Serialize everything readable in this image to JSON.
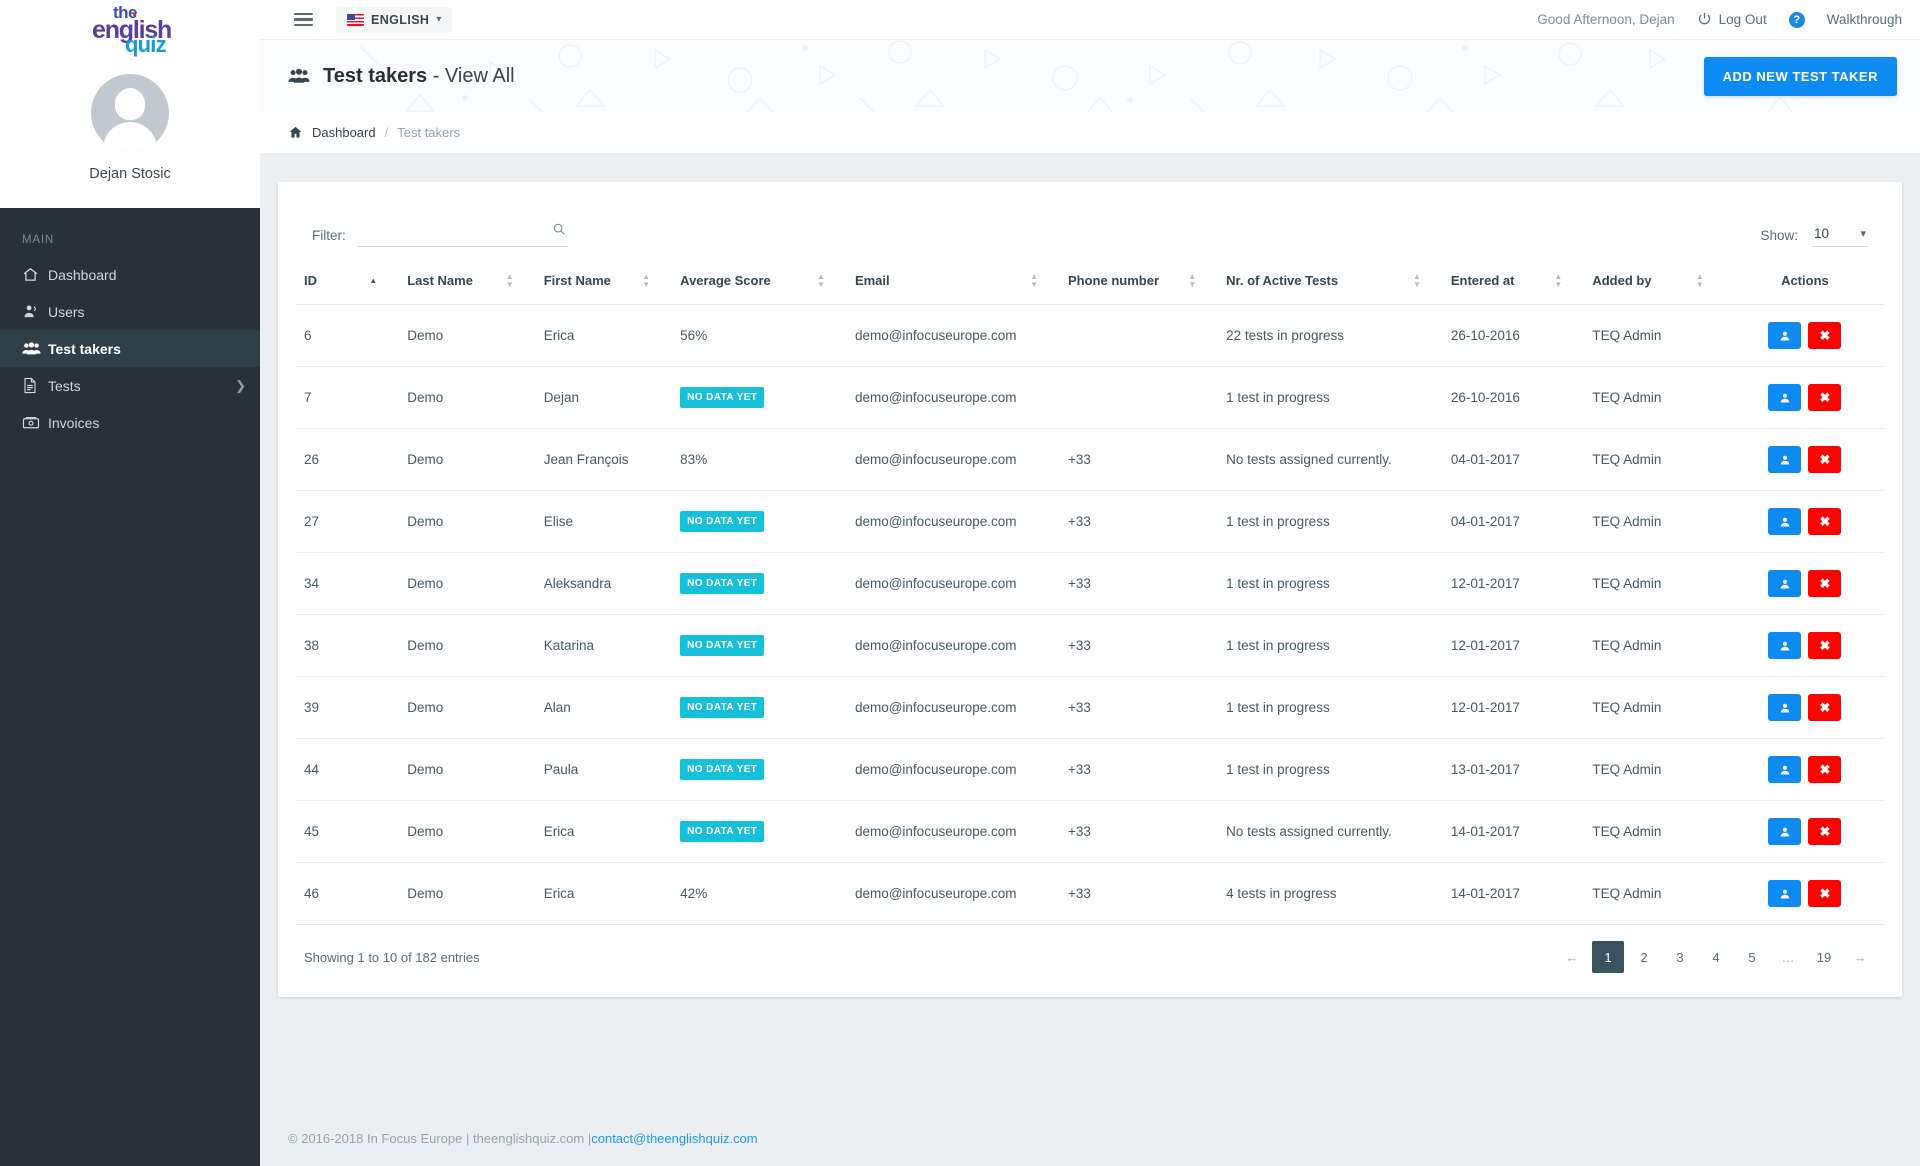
{
  "sidebar": {
    "logo": {
      "line1": "the",
      "line2": "english",
      "line3": "quiz"
    },
    "profile_name": "Dejan Stosic",
    "section_label": "MAIN",
    "items": [
      {
        "label": "Dashboard",
        "icon": "home-icon"
      },
      {
        "label": "Users",
        "icon": "user-icon"
      },
      {
        "label": "Test takers",
        "icon": "users-group-icon"
      },
      {
        "label": "Tests",
        "icon": "document-icon"
      },
      {
        "label": "Invoices",
        "icon": "money-icon"
      }
    ]
  },
  "topbar": {
    "language": "ENGLISH",
    "greeting": "Good Afternoon, Dejan",
    "logout": "Log Out",
    "help": "?",
    "walkthrough": "Walkthrough"
  },
  "pagehead": {
    "title": "Test takers",
    "subtitle": "- View All",
    "add_button": "ADD NEW TEST TAKER"
  },
  "breadcrumb": {
    "home": "home-icon",
    "parent": "Dashboard",
    "sep": "/",
    "current": "Test takers"
  },
  "toolbar": {
    "filter_label": "Filter:",
    "filter_value": "",
    "filter_placeholder": "",
    "show_label": "Show:",
    "show_value": "10"
  },
  "table": {
    "columns": [
      {
        "label": "ID",
        "sort": "asc"
      },
      {
        "label": "Last Name",
        "sort": "none"
      },
      {
        "label": "First Name",
        "sort": "none"
      },
      {
        "label": "Average Score",
        "sort": "none"
      },
      {
        "label": "Email",
        "sort": "none"
      },
      {
        "label": "Phone number",
        "sort": "none"
      },
      {
        "label": "Nr. of Active Tests",
        "sort": "none"
      },
      {
        "label": "Entered at",
        "sort": "none"
      },
      {
        "label": "Added by",
        "sort": "none"
      },
      {
        "label": "Actions",
        "sort": ""
      }
    ],
    "rows": [
      {
        "id": "6",
        "last": "Demo",
        "first": "Erica",
        "score": "56%",
        "badge": false,
        "email": "demo@infocuseurope.com",
        "phone": "",
        "tests": "22 tests in progress",
        "entered": "26-10-2016",
        "added": "TEQ Admin"
      },
      {
        "id": "7",
        "last": "Demo",
        "first": "Dejan",
        "score": "NO DATA YET",
        "badge": true,
        "email": "demo@infocuseurope.com",
        "phone": "",
        "tests": "1 test in progress",
        "entered": "26-10-2016",
        "added": "TEQ Admin"
      },
      {
        "id": "26",
        "last": "Demo",
        "first": "Jean François",
        "score": "83%",
        "badge": false,
        "email": "demo@infocuseurope.com",
        "phone": "+33",
        "tests": "No tests assigned currently.",
        "entered": "04-01-2017",
        "added": "TEQ Admin"
      },
      {
        "id": "27",
        "last": "Demo",
        "first": "Elise",
        "score": "NO DATA YET",
        "badge": true,
        "email": "demo@infocuseurope.com",
        "phone": "+33",
        "tests": "1 test in progress",
        "entered": "04-01-2017",
        "added": "TEQ Admin"
      },
      {
        "id": "34",
        "last": "Demo",
        "first": "Aleksandra",
        "score": "NO DATA YET",
        "badge": true,
        "email": "demo@infocuseurope.com",
        "phone": "+33",
        "tests": "1 test in progress",
        "entered": "12-01-2017",
        "added": "TEQ Admin"
      },
      {
        "id": "38",
        "last": "Demo",
        "first": "Katarina",
        "score": "NO DATA YET",
        "badge": true,
        "email": "demo@infocuseurope.com",
        "phone": "+33",
        "tests": "1 test in progress",
        "entered": "12-01-2017",
        "added": "TEQ Admin"
      },
      {
        "id": "39",
        "last": "Demo",
        "first": "Alan",
        "score": "NO DATA YET",
        "badge": true,
        "email": "demo@infocuseurope.com",
        "phone": "+33",
        "tests": "1 test in progress",
        "entered": "12-01-2017",
        "added": "TEQ Admin"
      },
      {
        "id": "44",
        "last": "Demo",
        "first": "Paula",
        "score": "NO DATA YET",
        "badge": true,
        "email": "demo@infocuseurope.com",
        "phone": "+33",
        "tests": "1 test in progress",
        "entered": "13-01-2017",
        "added": "TEQ Admin"
      },
      {
        "id": "45",
        "last": "Demo",
        "first": "Erica",
        "score": "NO DATA YET",
        "badge": true,
        "email": "demo@infocuseurope.com",
        "phone": "+33",
        "tests": "No tests assigned currently.",
        "entered": "14-01-2017",
        "added": "TEQ Admin"
      },
      {
        "id": "46",
        "last": "Demo",
        "first": "Erica",
        "score": "42%",
        "badge": false,
        "email": "demo@infocuseurope.com",
        "phone": "+33",
        "tests": "4 tests in progress",
        "entered": "14-01-2017",
        "added": "TEQ Admin"
      }
    ]
  },
  "tablefoot": {
    "entries": "Showing 1 to 10 of 182 entries",
    "pages": [
      "←",
      "1",
      "2",
      "3",
      "4",
      "5",
      "…",
      "19",
      "→"
    ],
    "active_page": "1"
  },
  "footer": {
    "text": "© 2016-2018 In Focus Europe | theenglishquiz.com | ",
    "email": "contact@theenglishquiz.com"
  },
  "colors": {
    "accent_blue": "#0d8bf2",
    "badge_cyan": "#16c0d8",
    "danger_red": "#fb0400",
    "sidebar_dark": "#263238"
  }
}
